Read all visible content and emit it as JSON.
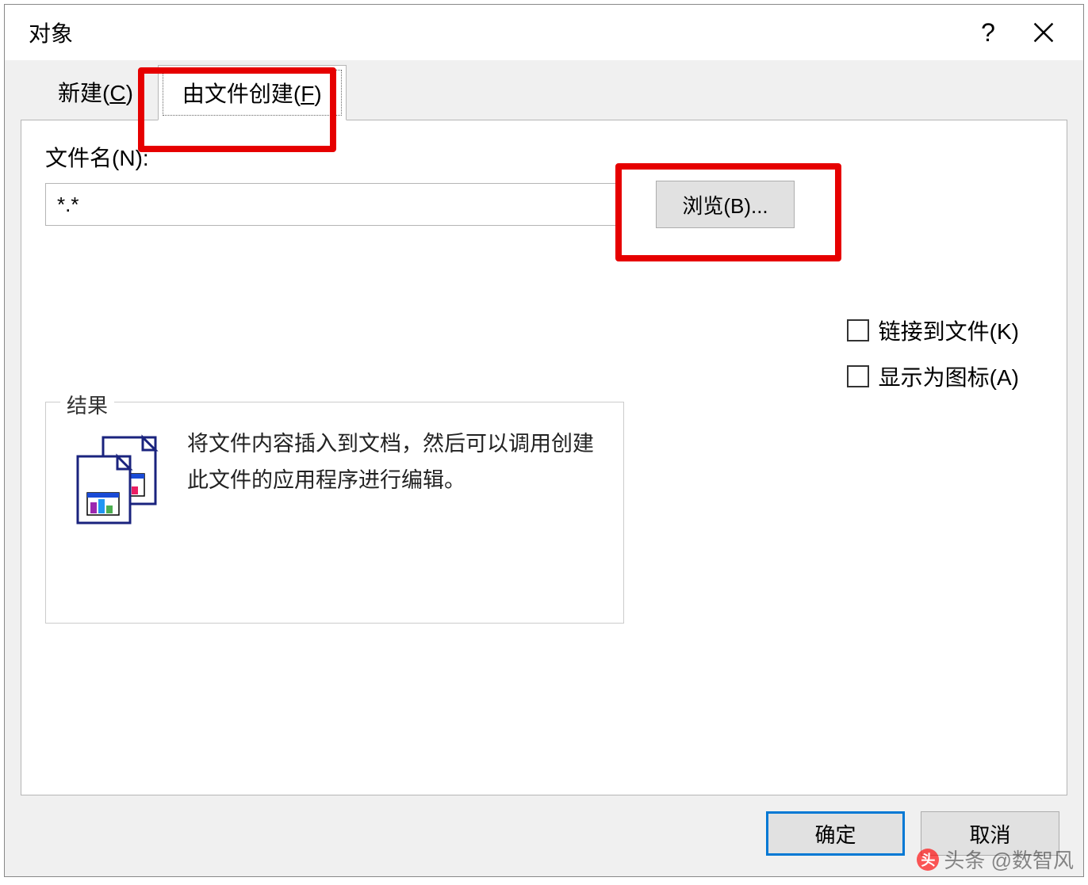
{
  "dialog": {
    "title": "对象",
    "tabs": {
      "create_new": "新建(C)",
      "create_from_file": "由文件创建(F)"
    },
    "filename_label": "文件名(N):",
    "filename_value": "*.*",
    "browse_button": "浏览(B)...",
    "checkboxes": {
      "link_to_file": "链接到文件(K)",
      "display_as_icon": "显示为图标(A)"
    },
    "result": {
      "legend": "结果",
      "description": "将文件内容插入到文档，然后可以调用创建此文件的应用程序进行编辑。"
    },
    "buttons": {
      "ok": "确定",
      "cancel": "取消"
    }
  },
  "watermark": "头条 @数智风"
}
